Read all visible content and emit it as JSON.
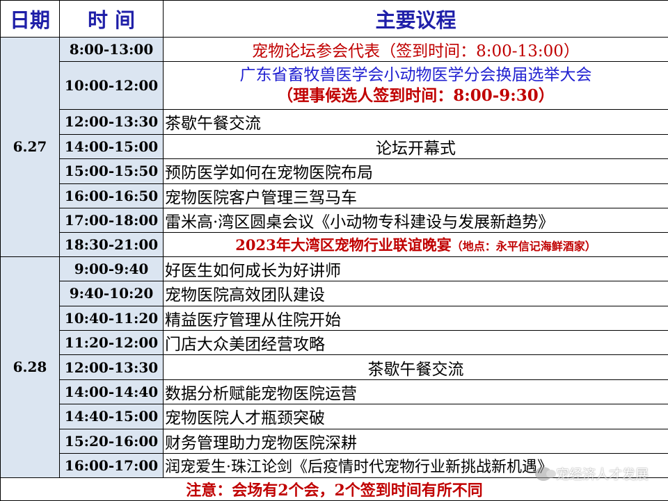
{
  "header": {
    "date_label": "日期",
    "time_label": "时 间",
    "topic_label": "主要议程"
  },
  "day1": {
    "date": "6.27",
    "rows": [
      {
        "time": "8:00-13:00",
        "topic": "宠物论坛参会代表（签到时间：8:00-13:00）"
      },
      {
        "time": "10:00-12:00",
        "topic": "广东省畜牧兽医学会小动物医学分会换届选举大会",
        "topic2": "（理事候选人签到时间：8:00-9:30）"
      },
      {
        "time": "12:00-13:30",
        "topic": "茶歇午餐交流"
      },
      {
        "time": "14:00-15:00",
        "topic": "论坛开幕式"
      },
      {
        "time": "15:00-15:50",
        "topic": "预防医学如何在宠物医院布局"
      },
      {
        "time": "16:00-16:50",
        "topic": "宠物医院客户管理三驾马车"
      },
      {
        "time": "17:00-18:00",
        "topic": "雷米高·湾区圆桌会议《小动物专科建设与发展新趋势》"
      },
      {
        "time": "18:30-21:00",
        "topic": "2023年大湾区宠物行业联谊晚宴",
        "note": "（地点：永平信记海鲜酒家）"
      }
    ]
  },
  "day2": {
    "date": "6.28",
    "rows": [
      {
        "time": "9:00-9:40",
        "topic": "好医生如何成长为好讲师"
      },
      {
        "time": "9:40-10:20",
        "topic": "宠物医院高效团队建设"
      },
      {
        "time": "10:40-11:20",
        "topic": "精益医疗管理从住院开始"
      },
      {
        "time": "11:20-12:00",
        "topic": "门店大众美团经营攻略"
      },
      {
        "time": "12:00-13:30",
        "topic": "茶歇午餐交流"
      },
      {
        "time": "14:00-14:40",
        "topic": "数据分析赋能宠物医院运营"
      },
      {
        "time": "14:40-15:00",
        "topic": "宠物医院人才瓶颈突破"
      },
      {
        "time": "15:20-16:00",
        "topic": "财务管理助力宠物医院深耕"
      },
      {
        "time": "16:00-17:00",
        "topic": "润宠爱生·珠江论剑《后疫情时代宠物行业新挑战新机遇》"
      }
    ]
  },
  "notice": "注意：会场有2个会，2个签到时间有所不同",
  "watermark": "宠经济人才发展",
  "colors": {
    "header_text": "#1f1fa8",
    "cell_bg": "#dbe5f1",
    "red": "#c00000",
    "blue": "#1f1fd0"
  }
}
